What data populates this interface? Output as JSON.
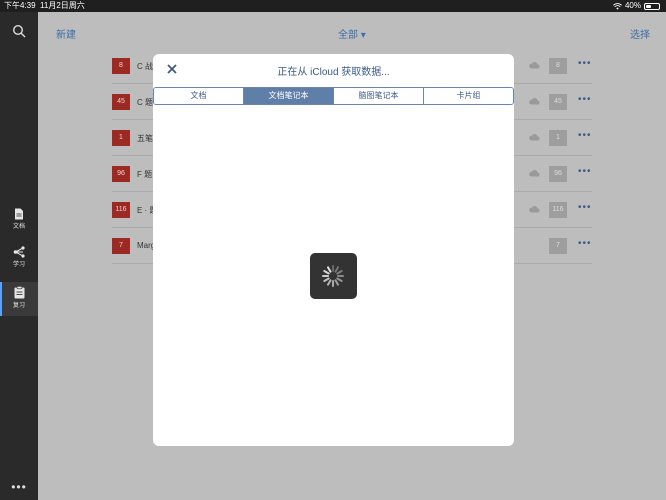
{
  "status_bar": {
    "time": "下午4:39",
    "date": "11月2日周六",
    "battery_percent": "40%",
    "battery_level": 0.4,
    "wifi_icon": "wifi-icon"
  },
  "sidebar": {
    "search_icon": "search-icon",
    "items": [
      {
        "label": "文档",
        "icon": "document-icon"
      },
      {
        "label": "学习",
        "icon": "share-network-icon"
      },
      {
        "label": "复习",
        "icon": "clipboard-icon",
        "active": true
      }
    ],
    "more": "•••"
  },
  "topbar": {
    "new_label": "新建",
    "filter_label": "全部 ▾",
    "select_label": "选择"
  },
  "list": [
    {
      "badge": "8",
      "title": "C 战",
      "count": "8",
      "cloud": true
    },
    {
      "badge": "45",
      "title": "C 题",
      "count": "45",
      "cloud": true
    },
    {
      "badge": "1",
      "title": "五笔",
      "count": "1",
      "cloud": true
    },
    {
      "badge": "96",
      "title": "F 题",
      "count": "96",
      "cloud": true
    },
    {
      "badge": "116",
      "title": "E · 题",
      "count": "116",
      "cloud": true
    },
    {
      "badge": "7",
      "title": "Marg",
      "count": "7",
      "cloud": false
    }
  ],
  "modal": {
    "title": "正在从 iCloud 获取数据...",
    "tabs": [
      "文档",
      "文档笔记本",
      "脑图笔记本",
      "卡片组"
    ],
    "active_tab": 1
  },
  "colors": {
    "accent": "#3d5a85",
    "tab_active": "#5f7fa9",
    "badge_red": "#9c2a24"
  }
}
